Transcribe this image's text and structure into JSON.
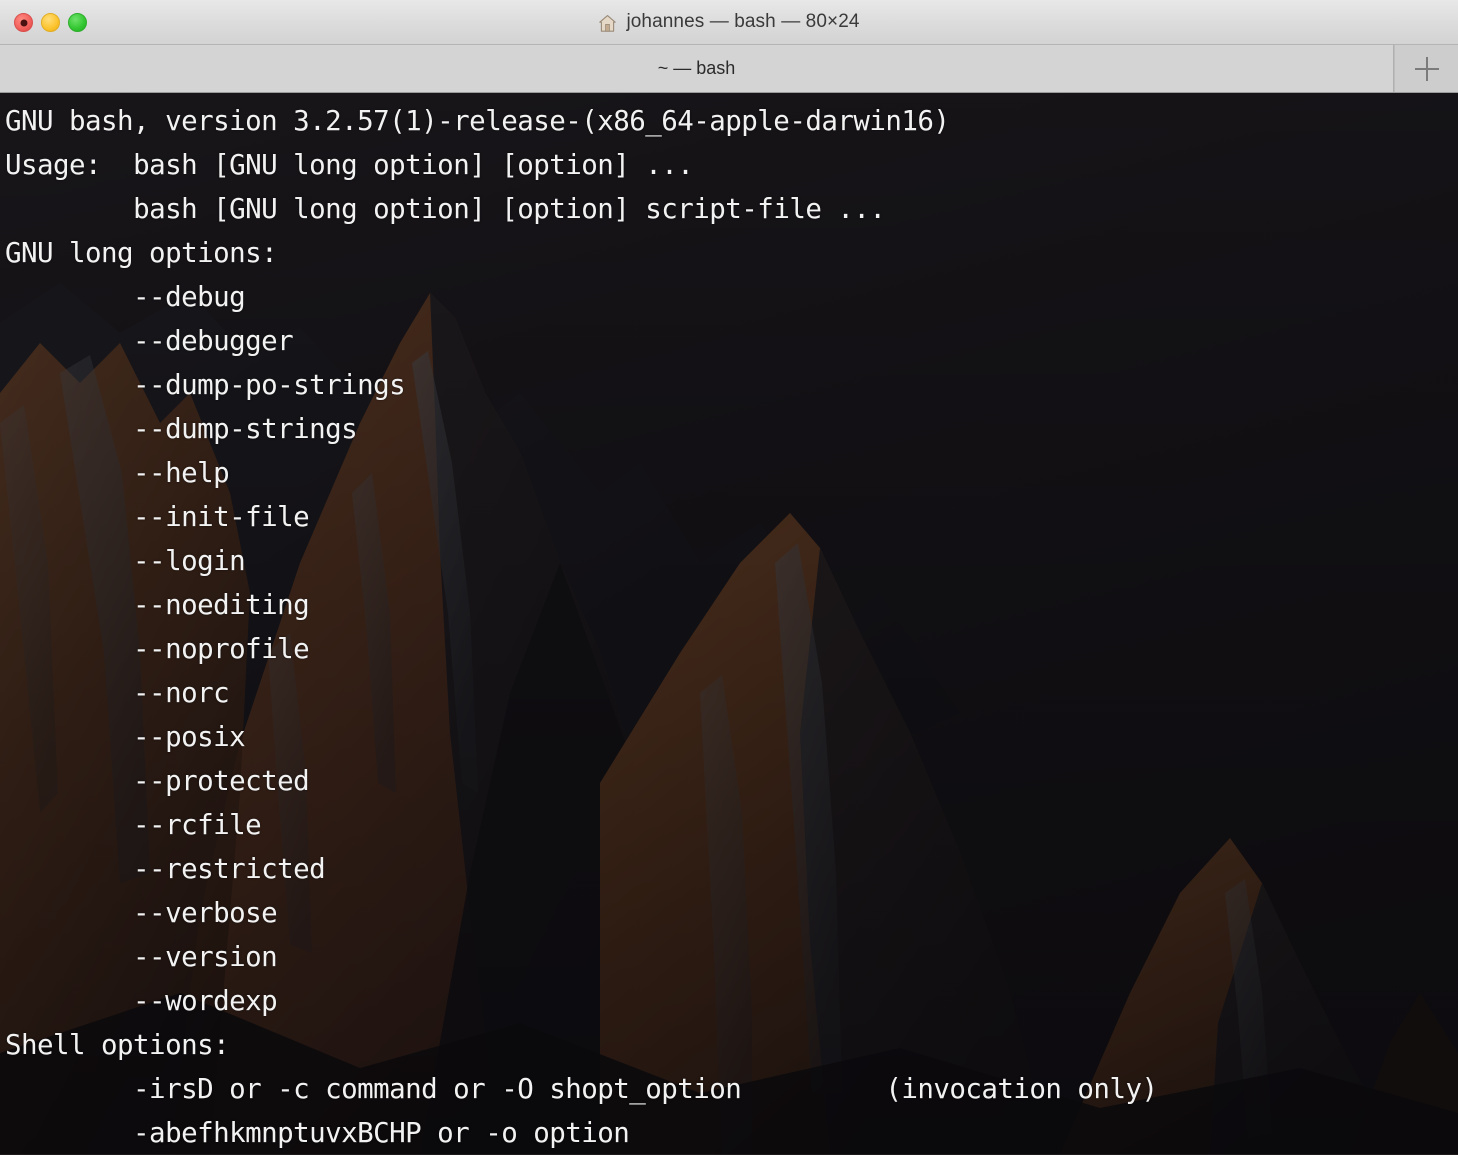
{
  "window": {
    "title": "johannes — bash — 80×24",
    "title_icon": "home-icon",
    "traffic_lights": {
      "close_label": "close",
      "minimize_label": "minimize",
      "zoom_label": "zoom"
    }
  },
  "tabbar": {
    "tabs": [
      {
        "label": "~ — bash",
        "active": true
      }
    ],
    "new_tab_icon": "plus-icon",
    "new_tab_label": "+"
  },
  "terminal": {
    "columns": 80,
    "rows": 24,
    "shell": "bash",
    "foreground_color": "#f2f2f2",
    "background_color": "#191617",
    "content": "GNU bash, version 3.2.57(1)-release-(x86_64-apple-darwin16)\nUsage:\tbash [GNU long option] [option] ...\n\tbash [GNU long option] [option] script-file ...\nGNU long options:\n        --debug\n        --debugger\n        --dump-po-strings\n        --dump-strings\n        --help\n        --init-file\n        --login\n        --noediting\n        --noprofile\n        --norc\n        --posix\n        --protected\n        --rcfile\n        --restricted\n        --verbose\n        --version\n        --wordexp\nShell options:\n        -irsD or -c command or -O shopt_option         (invocation only)\n        -abefhkmnptuvxBCHP or -o option",
    "lines": [
      "GNU bash, version 3.2.57(1)-release-(x86_64-apple-darwin16)",
      "Usage:  bash [GNU long option] [option] ...",
      "        bash [GNU long option] [option] script-file ...",
      "GNU long options:",
      "        --debug",
      "        --debugger",
      "        --dump-po-strings",
      "        --dump-strings",
      "        --help",
      "        --init-file",
      "        --login",
      "        --noediting",
      "        --noprofile",
      "        --norc",
      "        --posix",
      "        --protected",
      "        --rcfile",
      "        --restricted",
      "        --verbose",
      "        --version",
      "        --wordexp",
      "Shell options:",
      "        -irsD or -c command or -O shopt_option         (invocation only)",
      "        -abefhkmnptuvxBCHP or -o option"
    ]
  }
}
